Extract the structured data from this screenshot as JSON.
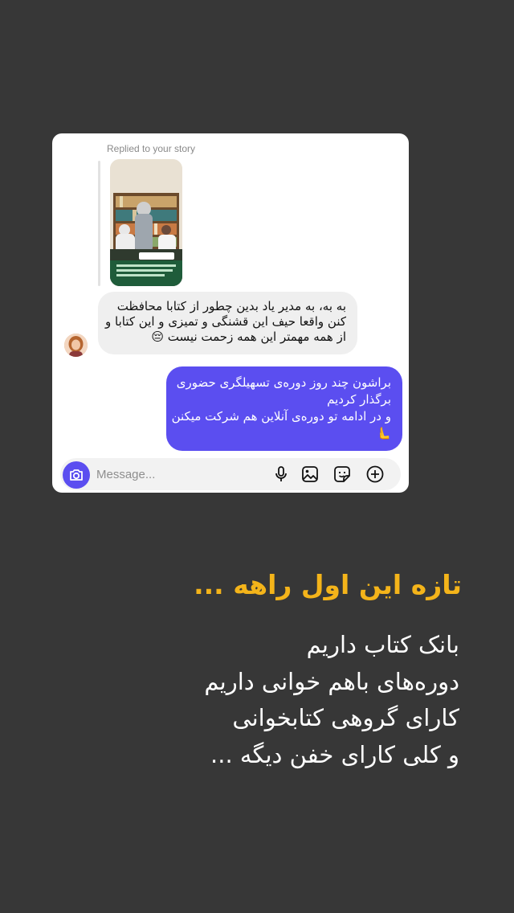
{
  "story_reply": {
    "replied_label": "Replied to your story",
    "thumbnail_caption": "آکادمی"
  },
  "messages": {
    "incoming": [
      "به به، به مدیر یاد بدین چطور از کتابا محافظت",
      "کنن واقعا حیف این قشنگی و تمیزی و این کتابا و",
      "از همه مهمتر این همه زحمت نیست 😔"
    ],
    "outgoing": [
      "براشون چند روز دوره‌ی تسهیلگری  حضوری",
      "برگذار کردیم",
      "و در ادامه تو دوره‌ی آنلاین هم شرکت میکنن",
      "🫷"
    ]
  },
  "composer": {
    "placeholder": "Message...",
    "icons": [
      "camera-icon",
      "microphone-icon",
      "gallery-icon",
      "sticker-icon",
      "add-icon"
    ]
  },
  "caption": {
    "headline": "تازه این اول راهه ...",
    "lines": [
      "بانک کتاب داریم",
      "دوره‌های باهم خوانی داریم",
      "کارای گروهی کتابخوانی",
      "و کلی کارای خفن دیگه ..."
    ]
  },
  "colors": {
    "background": "#373737",
    "accent": "#5b4ef0",
    "headline": "#f4b41a",
    "incoming_bubble": "#efefef"
  }
}
